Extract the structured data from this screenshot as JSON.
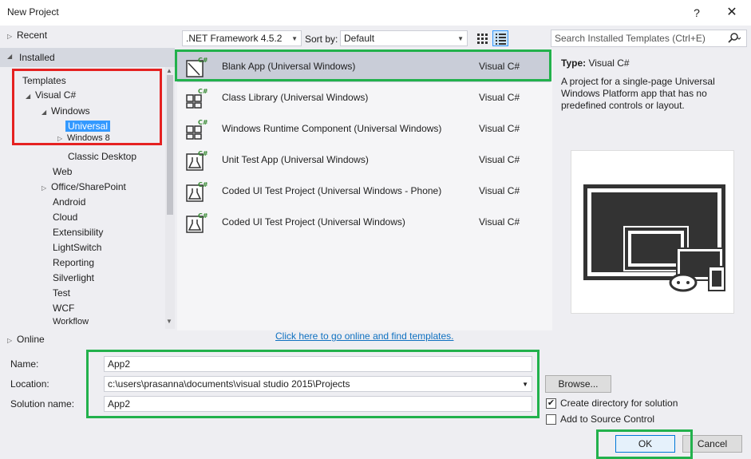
{
  "window": {
    "title": "New Project",
    "help": "?",
    "close": "✕"
  },
  "tree": {
    "recent": "Recent",
    "installed": "Installed",
    "templates": "Templates",
    "visual_csharp": "Visual C#",
    "windows": "Windows",
    "universal": "Universal",
    "windows8": "Windows 8",
    "classic_desktop": "Classic Desktop",
    "web": "Web",
    "office": "Office/SharePoint",
    "android": "Android",
    "cloud": "Cloud",
    "extensibility": "Extensibility",
    "lightswitch": "LightSwitch",
    "reporting": "Reporting",
    "silverlight": "Silverlight",
    "test": "Test",
    "wcf": "WCF",
    "workflow": "Workflow",
    "online": "Online"
  },
  "toolbar": {
    "framework": ".NET Framework 4.5.2",
    "sort_label": "Sort by:",
    "sort_value": "Default",
    "search_placeholder": "Search Installed Templates (Ctrl+E)"
  },
  "templates": [
    {
      "name": "Blank App (Universal Windows)",
      "lang": "Visual C#"
    },
    {
      "name": "Class Library (Universal Windows)",
      "lang": "Visual C#"
    },
    {
      "name": "Windows Runtime Component (Universal Windows)",
      "lang": "Visual C#"
    },
    {
      "name": "Unit Test App (Universal Windows)",
      "lang": "Visual C#"
    },
    {
      "name": "Coded UI Test Project (Universal Windows - Phone)",
      "lang": "Visual C#"
    },
    {
      "name": "Coded UI Test Project (Universal Windows)",
      "lang": "Visual C#"
    }
  ],
  "online_link": "Click here to go online and find templates.",
  "details": {
    "type_label": "Type:",
    "type_value": "Visual C#",
    "description": "A project for a single-page Universal Windows Platform app that has no predefined controls or layout."
  },
  "form": {
    "name_label": "Name:",
    "name_value": "App2",
    "location_label": "Location:",
    "location_value": "c:\\users\\prasanna\\documents\\visual studio 2015\\Projects",
    "solution_label": "Solution name:",
    "solution_value": "App2",
    "browse": "Browse...",
    "create_dir": "Create directory for solution",
    "create_dir_checked": true,
    "source_control": "Add to Source Control",
    "source_control_checked": false,
    "ok": "OK",
    "cancel": "Cancel"
  },
  "colors": {
    "accent": "#3399ff",
    "highlight_red": "#e52121",
    "highlight_green": "#22b14c",
    "link": "#0e70c0"
  }
}
